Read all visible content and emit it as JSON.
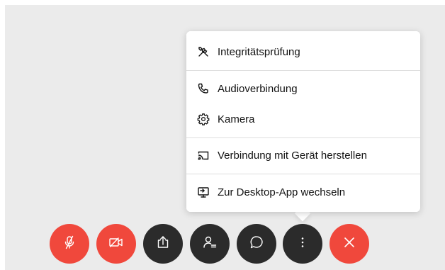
{
  "menu": {
    "items": [
      {
        "label": "Integritätsprüfung",
        "icon": "tools-icon"
      },
      {
        "label": "Audioverbindung",
        "icon": "phone-icon"
      },
      {
        "label": "Kamera",
        "icon": "gear-icon"
      },
      {
        "label": "Verbindung mit Gerät herstellen",
        "icon": "cast-icon"
      },
      {
        "label": "Zur Desktop-App wechseln",
        "icon": "desktop-app-icon"
      }
    ]
  },
  "controls": [
    {
      "name": "mute-button",
      "icon": "mic-muted-icon",
      "color": "#f0483c"
    },
    {
      "name": "stop-video-button",
      "icon": "video-off-icon",
      "color": "#f0483c"
    },
    {
      "name": "share-button",
      "icon": "share-icon",
      "color": "#2b2b2b"
    },
    {
      "name": "participants-button",
      "icon": "participants-icon",
      "color": "#2b2b2b"
    },
    {
      "name": "chat-button",
      "icon": "chat-bubble-icon",
      "color": "#2b2b2b"
    },
    {
      "name": "more-options-button",
      "icon": "more-vertical-icon",
      "color": "#2b2b2b"
    },
    {
      "name": "leave-meeting-button",
      "icon": "close-icon",
      "color": "#f0483c"
    }
  ],
  "colors": {
    "background": "#ebebeb",
    "danger": "#f0483c",
    "dark": "#2b2b2b",
    "menu_bg": "#ffffff",
    "text": "#121212"
  }
}
